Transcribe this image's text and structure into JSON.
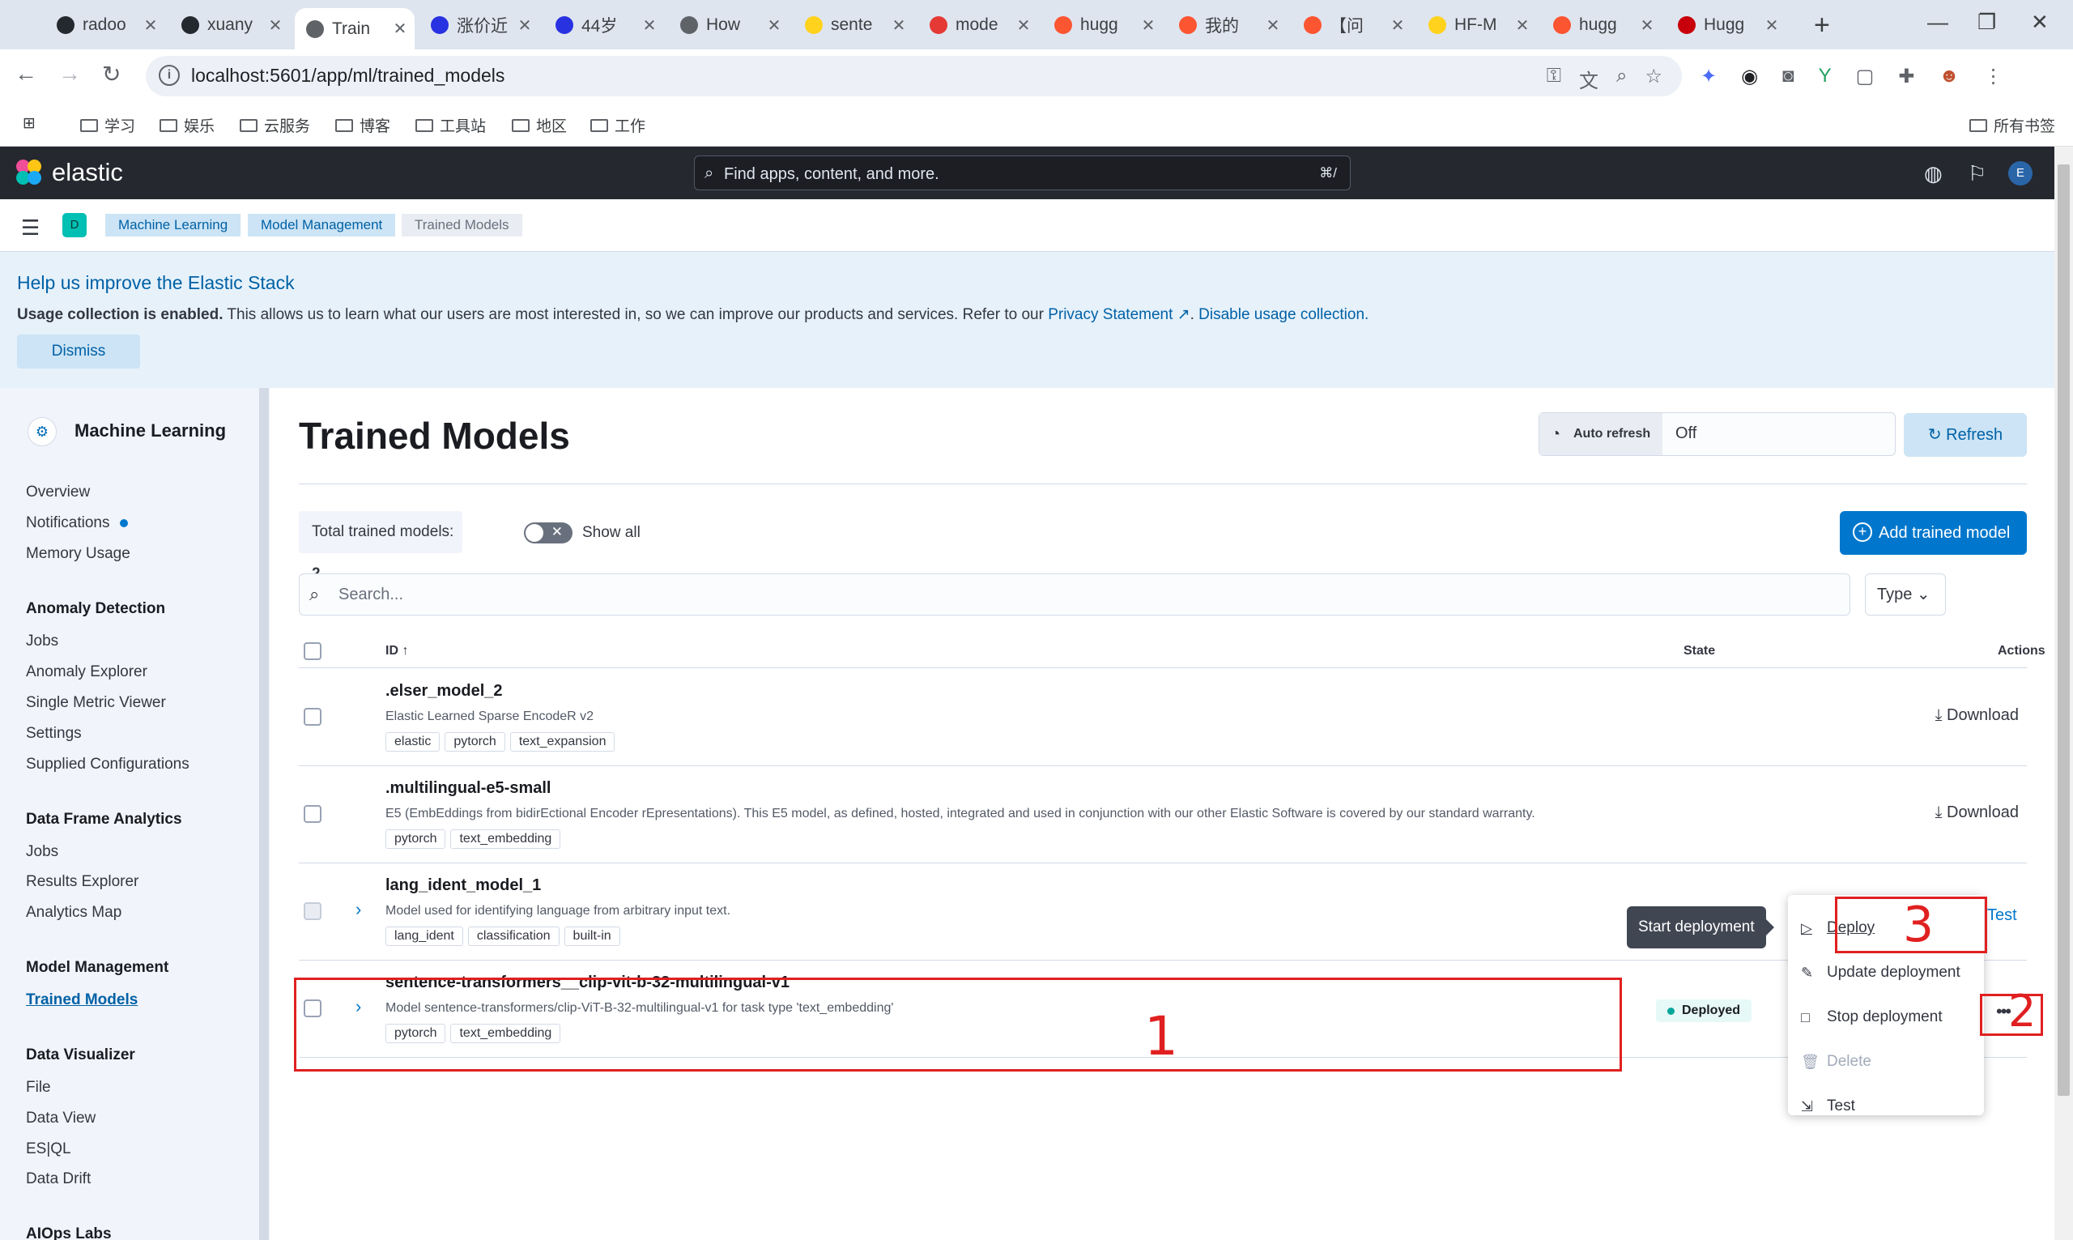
{
  "browser": {
    "tabs": [
      {
        "title": "radoo",
        "icon_color": "#24292f",
        "icon": "github-icon"
      },
      {
        "title": "xuany",
        "icon_color": "#24292f",
        "icon": "github-icon"
      },
      {
        "title": "Train",
        "icon_color": "#5f6368",
        "icon": "elastic-icon",
        "active": true
      },
      {
        "title": "涨价近",
        "icon_color": "#2932e1",
        "icon": "baidu-icon"
      },
      {
        "title": "44岁",
        "icon_color": "#2932e1",
        "icon": "baidu-icon"
      },
      {
        "title": "How",
        "icon_color": "#5f6368",
        "icon": "openai-icon"
      },
      {
        "title": "sente",
        "icon_color": "#ffd21e",
        "icon": "huggingface-icon"
      },
      {
        "title": "mode",
        "icon_color": "#e53935",
        "icon": "gitee-icon"
      },
      {
        "title": "hugg",
        "icon_color": "#fc5531",
        "icon": "csdn-icon"
      },
      {
        "title": "我的",
        "icon_color": "#fc5531",
        "icon": "csdn-icon"
      },
      {
        "title": "【问",
        "icon_color": "#fc5531",
        "icon": "csdn-icon"
      },
      {
        "title": "HF-M",
        "icon_color": "#ffd21e",
        "icon": "huggingface-icon"
      },
      {
        "title": "hugg",
        "icon_color": "#fc5531",
        "icon": "csdn-icon"
      },
      {
        "title": "Hugg",
        "icon_color": "#c7000b",
        "icon": "huawei-icon"
      }
    ],
    "url": "localhost:5601/app/ml/trained_models",
    "bookmarks": [
      "学习",
      "娱乐",
      "云服务",
      "博客",
      "工具站",
      "地区",
      "工作"
    ],
    "all_bookmarks": "所有书签"
  },
  "kibana": {
    "brand": "elastic",
    "search_placeholder": "Find apps, content, and more.",
    "search_shortcut": "⌘/",
    "avatar": "E",
    "space": "D",
    "breadcrumbs": [
      "Machine Learning",
      "Model Management",
      "Trained Models"
    ]
  },
  "callout": {
    "title": "Help us improve the Elastic Stack",
    "body_bold": "Usage collection is enabled.",
    "body": " This allows us to learn what our users are most interested in, so we can improve our products and services. Refer to our ",
    "privacy_link": "Privacy Statement",
    "disable_link": "Disable usage collection.",
    "dismiss": "Dismiss"
  },
  "sidenav": {
    "title": "Machine Learning",
    "top_items": [
      "Overview",
      "Notifications",
      "Memory Usage"
    ],
    "anomaly_head": "Anomaly Detection",
    "anomaly_items": [
      "Jobs",
      "Anomaly Explorer",
      "Single Metric Viewer",
      "Settings",
      "Supplied Configurations"
    ],
    "dfa_head": "Data Frame Analytics",
    "dfa_items": [
      "Jobs",
      "Results Explorer",
      "Analytics Map"
    ],
    "mm_head": "Model Management",
    "mm_items": [
      "Trained Models"
    ],
    "dv_head": "Data Visualizer",
    "dv_items": [
      "File",
      "Data View",
      "ES|QL",
      "Data Drift"
    ],
    "aiops_head": "AIOps Labs"
  },
  "main": {
    "title": "Trained Models",
    "auto_refresh_label": "Auto refresh",
    "auto_refresh_value": "Off",
    "refresh": "Refresh",
    "total_label": "Total trained models: ",
    "total_value": "2",
    "show_all": "Show all",
    "add_model": "Add trained model",
    "search_placeholder": "Search...",
    "type_filter": "Type",
    "columns": {
      "id": "ID",
      "state": "State",
      "actions": "Actions"
    },
    "rows": [
      {
        "id": ".elser_model_2",
        "desc": "Elastic Learned Sparse EncodeR v2",
        "tags": [
          "elastic",
          "pytorch",
          "text_expansion"
        ],
        "action": "Download"
      },
      {
        "id": ".multilingual-e5-small",
        "desc": "E5 (EmbEddings from bidirEctional Encoder rEpresentations). This E5 model, as defined, hosted, integrated and used in conjunction with our other Elastic Software is covered by our standard warranty.",
        "tags": [
          "pytorch",
          "text_embedding"
        ],
        "action": "Download"
      },
      {
        "id": "lang_ident_model_1",
        "desc": "Model used for identifying language from arbitrary input text.",
        "tags": [
          "lang_ident",
          "classification",
          "built-in"
        ],
        "action": "Test"
      },
      {
        "id": "sentence-transformers__clip-vit-b-32-multilingual-v1",
        "desc": "Model sentence-transformers/clip-ViT-B-32-multilingual-v1 for task type 'text_embedding'",
        "tags": [
          "pytorch",
          "text_embedding"
        ],
        "state": "Deployed"
      }
    ],
    "tooltip": "Start deployment",
    "menu": [
      "Deploy",
      "Update deployment",
      "Stop deployment",
      "Delete",
      "Test"
    ],
    "annotations": [
      "1",
      "2",
      "3"
    ]
  },
  "colors": {
    "accent": "#0077cc",
    "header": "#25282f",
    "annotation": "#e02020",
    "deployed": "#00a69b"
  }
}
